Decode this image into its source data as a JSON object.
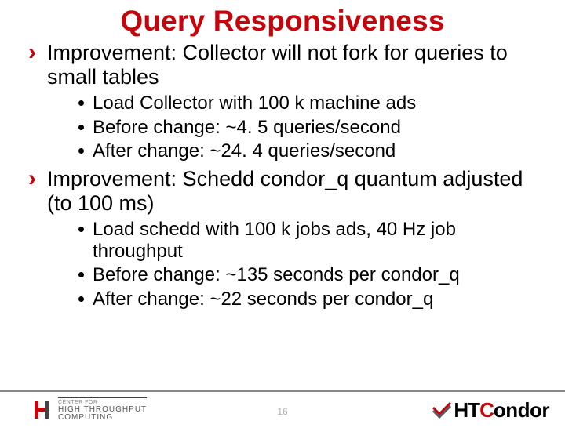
{
  "title": "Query Responsiveness",
  "bullets": {
    "b1": "Improvement: Collector will not fork for queries to small tables",
    "b1_sub": {
      "s1": "Load Collector with 100 k machine ads",
      "s2": "Before change: ~4. 5 queries/second",
      "s3": "After change: ~24. 4 queries/second"
    },
    "b2": "Improvement: Schedd condor_q quantum adjusted (to 100 ms)",
    "b2_sub": {
      "s1": "Load schedd with 100 k jobs ads, 40 Hz job throughput",
      "s2": "Before change: ~135 seconds per condor_q",
      "s3": "After change: ~22 seconds per condor_q"
    }
  },
  "footer": {
    "page": "16",
    "left_logo": {
      "line1": "CENTER FOR",
      "line2": "HIGH THROUGHPUT",
      "line3": "COMPUTING"
    },
    "right_logo": {
      "ht": "HT",
      "c": "C",
      "ondor": "ondor"
    }
  }
}
